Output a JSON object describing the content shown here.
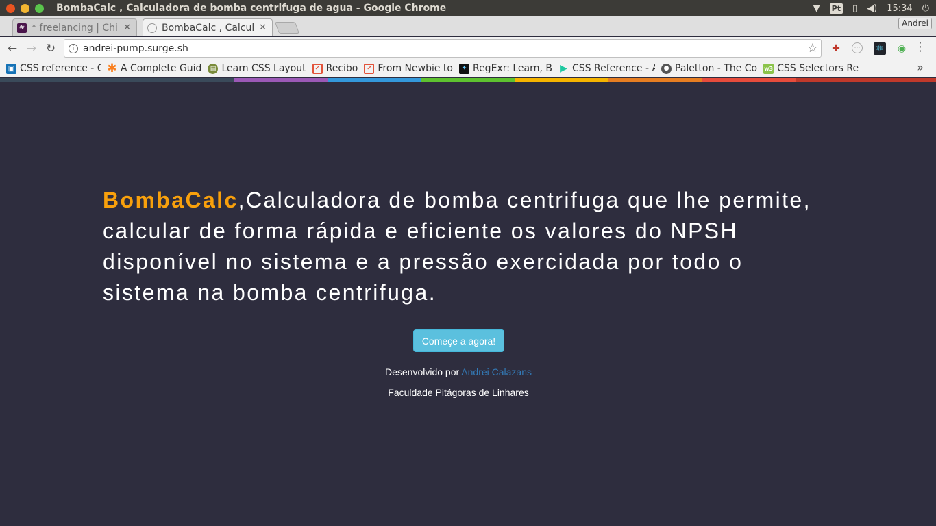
{
  "os": {
    "window_title": "BombaCalc , Calculadora de bomba centrifuga de agua - Google Chrome",
    "keyboard_layout": "Pt",
    "time": "15:34",
    "colors": {
      "close": "#e95420",
      "minimize": "#f2b631",
      "maximize": "#5ac44c"
    }
  },
  "browser": {
    "tabs": [
      {
        "title": "* freelancing | Chin",
        "icon": "slack-hash-icon",
        "active": false
      },
      {
        "title": "BombaCalc , Calcul",
        "icon": "globe-icon",
        "active": true
      }
    ],
    "profile_name": "Andrei",
    "url": "andrei-pump.surge.sh",
    "bookmarks": [
      {
        "label": "CSS reference - C",
        "icon": "css-book-icon"
      },
      {
        "label": "A Complete Guid",
        "icon": "asterisk-icon"
      },
      {
        "label": "Learn CSS Layout",
        "icon": "layout-icon"
      },
      {
        "label": "Recibo",
        "icon": "recibo-icon"
      },
      {
        "label": "From Newbie to",
        "icon": "recibo-icon"
      },
      {
        "label": "RegExr: Learn, B",
        "icon": "regexr-icon"
      },
      {
        "label": "CSS Reference - A",
        "icon": "play-icon"
      },
      {
        "label": "Paletton - The Co",
        "icon": "paletton-icon"
      },
      {
        "label": "CSS Selectors Ref",
        "icon": "w3-icon"
      }
    ],
    "stripe_colors": [
      "#2e2d3e",
      "#9b59b6",
      "#3498db",
      "#5ec230",
      "#f5b400",
      "#e67e22",
      "#e74c3c",
      "#c0392b"
    ]
  },
  "main": {
    "brand": "BombaCalc",
    "intro": ",Calculadora de bomba centrifuga que lhe permite, calcular de forma rápida e eficiente os valores do NPSH disponível no sistema e a pressão exercidada por todo o sistema na bomba centrifuga.",
    "cta_label": "Começe a agora!",
    "developed_by_prefix": "Desenvolvido por",
    "developer_name": "Andrei Calazans",
    "institution": "Faculdade Pitágoras de Linhares",
    "colors": {
      "background": "#2e2d3e",
      "brand": "#f8a00c",
      "cta": "#5bc0de",
      "link": "#337ab7"
    }
  }
}
